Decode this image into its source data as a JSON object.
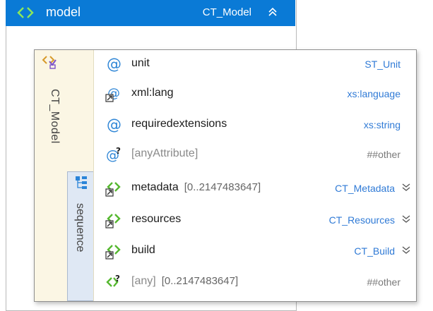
{
  "header": {
    "name": "model",
    "type": "CT_Model",
    "icon": "element-icon",
    "collapse_icon": "collapse-up-icon",
    "accent": "#0a7ad6"
  },
  "complex_type": {
    "label": "CT_Model",
    "icon": "complex-type-icon"
  },
  "attributes": [
    {
      "name": "unit",
      "type": "ST_Unit",
      "icon": "attribute-icon"
    },
    {
      "name": "xml:lang",
      "type": "xs:language",
      "icon": "attribute-ref-icon"
    },
    {
      "name": "requiredextensions",
      "type": "xs:string",
      "icon": "attribute-icon"
    },
    {
      "name": "[anyAttribute]",
      "type": "##other",
      "icon": "any-attribute-icon"
    }
  ],
  "sequence": {
    "label": "sequence",
    "icon": "sequence-icon",
    "children": [
      {
        "name": "metadata",
        "occurrence": "[0..2147483647]",
        "type": "CT_Metadata",
        "icon": "element-ref-icon",
        "expand_icon": "expand-down-icon"
      },
      {
        "name": "resources",
        "occurrence": "",
        "type": "CT_Resources",
        "icon": "element-ref-icon",
        "expand_icon": "expand-down-icon"
      },
      {
        "name": "build",
        "occurrence": "",
        "type": "CT_Build",
        "icon": "element-ref-icon",
        "expand_icon": "expand-down-icon"
      },
      {
        "name": "[any]",
        "occurrence": "[0..2147483647]",
        "type": "##other",
        "icon": "any-element-icon"
      }
    ]
  }
}
